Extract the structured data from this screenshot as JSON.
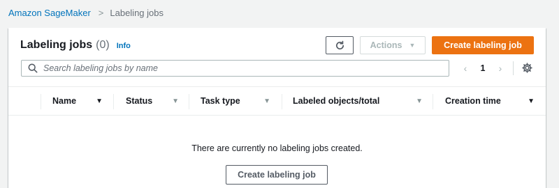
{
  "breadcrumb": {
    "items": [
      {
        "label": "Amazon SageMaker"
      },
      {
        "label": "Labeling jobs"
      }
    ],
    "separator": ">"
  },
  "panel": {
    "title": "Labeling jobs",
    "count": "(0)",
    "info_link": "Info"
  },
  "toolbar": {
    "refresh_icon": "refresh-icon",
    "actions_label": "Actions",
    "actions_caret": "▼",
    "create_label": "Create labeling job"
  },
  "search": {
    "placeholder": "Search labeling jobs by name",
    "value": ""
  },
  "pagination": {
    "prev": "‹",
    "page": "1",
    "next": "›"
  },
  "table": {
    "columns": [
      {
        "label": "Name",
        "sort": "▼"
      },
      {
        "label": "Status",
        "sort": "▼"
      },
      {
        "label": "Task type",
        "sort": "▼"
      },
      {
        "label": "Labeled objects/total",
        "sort": "▼"
      },
      {
        "label": "Creation time",
        "sort": "▼"
      }
    ]
  },
  "empty_state": {
    "message": "There are currently no labeling jobs created.",
    "button_label": "Create labeling job"
  },
  "colors": {
    "primary_orange": "#ec7211",
    "link_blue": "#0073bb",
    "background": "#f2f3f3"
  }
}
